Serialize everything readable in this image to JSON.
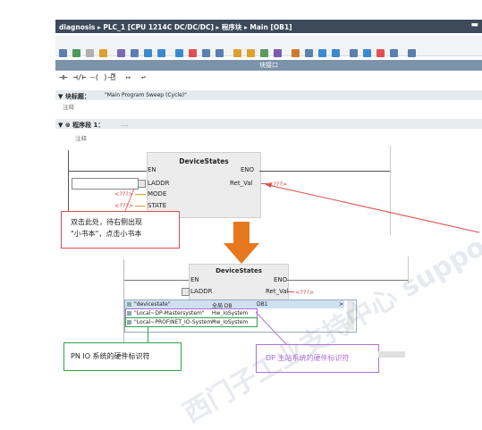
{
  "title_bar": {
    "path": "diagnosis ▸ PLC_1 [CPU 1214C DC/DC/DC] ▸ 程序块 ▸ Main [OB1]",
    "window_btn": "▬"
  },
  "toolbar": {
    "block_interface_label": "块接口",
    "ladder_symbols": [
      "⊣⊢",
      "⊣/⊢",
      "–( )–",
      "⍰",
      "↦",
      "↩"
    ]
  },
  "block_title": {
    "label": "▼ 块标题：",
    "value": "\"Main Program Sweep (Cycle)\"",
    "comment": "注释"
  },
  "network": {
    "label": "▼ ⊗ 程序段 1：",
    "dots": "....",
    "comment": "注释"
  },
  "fb_top": {
    "name": "DeviceStates",
    "en": "EN",
    "eno": "ENO",
    "laddr": "LADDR",
    "ret_val": "Ret_Val",
    "mode": "MODE",
    "state": "STATE",
    "placeholder": "<???>",
    "ret_placeholder": "<???>"
  },
  "callout_hint": {
    "line1": "双击此处，待右侧出现",
    "line2": "\"小书本\"，点击小书本"
  },
  "fb_bottom": {
    "name": "DeviceStates",
    "en": "EN",
    "eno": "ENO",
    "laddr": "LADDR",
    "ret_val": "Ret_Val",
    "ret_placeholder": "<???>"
  },
  "dropdown": {
    "rows": [
      {
        "name": "\"devicestate\"",
        "type": "全局 DB",
        "value": "DB1",
        "extra": ">"
      },
      {
        "name": "\"Local~DP-Mastersystem\"",
        "type": "Hw_IoSystem",
        "value": "",
        "extra": ""
      },
      {
        "name": "\"Local~PROFINET_IO-System\"",
        "type": "Hw_IoSystem",
        "value": "",
        "extra": ""
      }
    ]
  },
  "callout_pn": {
    "text": "PN IO 系统的硬件标识符"
  },
  "callout_dp": {
    "text": "DP 主站系统的硬件标识符"
  },
  "colors": {
    "red": "#d85050",
    "green": "#2aa84a",
    "purple": "#b070d8",
    "orange": "#e8781e"
  },
  "watermark": "西门子工业支持中心 support.industry.siemens.com/cs"
}
